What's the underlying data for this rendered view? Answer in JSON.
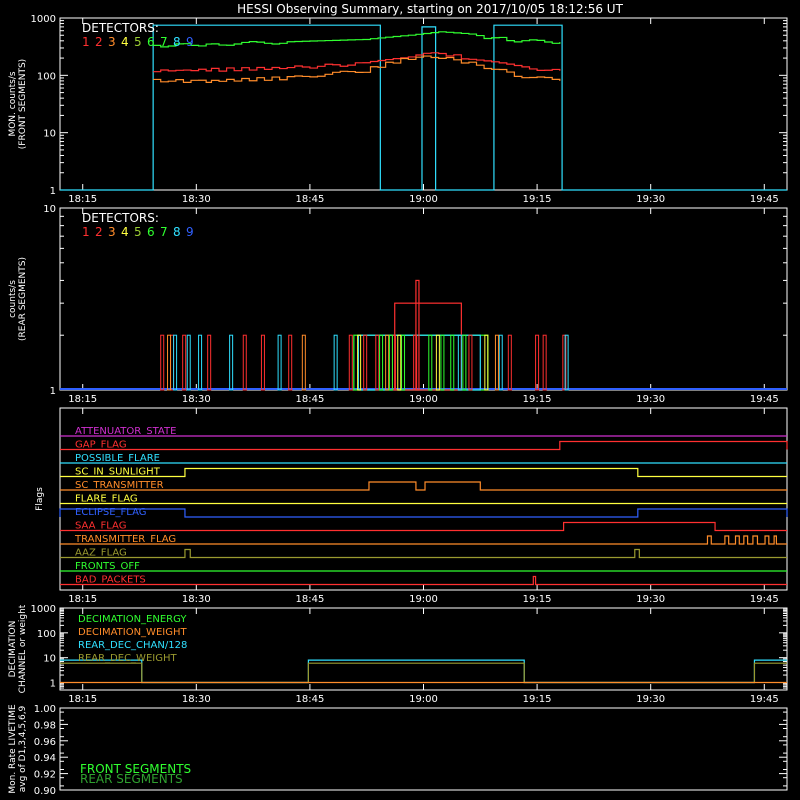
{
  "title": "HESSI Observing Summary, starting on 2017/10/05 18:12:56 UT",
  "colors": {
    "d1": "#ff3030",
    "d2": "#ff3030",
    "d3": "#ff8c2a",
    "d4": "#ffff40",
    "d5": "#9acd32",
    "d6": "#30ff30",
    "d7": "#30ff30",
    "d8": "#30e0ff",
    "d9": "#3060ff",
    "frame": "#ffffff"
  },
  "chart_data": [
    {
      "type": "line",
      "id": "front",
      "ylabel": "MON. counts/s\n(FRONT SEGMENTS)",
      "yscale": "log",
      "ylim": [
        1,
        1000
      ],
      "yticks": [
        "1",
        "10",
        "100",
        "1000"
      ],
      "xlim_min": [
        0,
        96
      ],
      "xticks": [
        "18:15",
        "18:30",
        "18:45",
        "19:00",
        "19:15",
        "19:30",
        "19:45"
      ],
      "xticks_min": [
        3,
        18,
        33,
        48,
        63,
        78,
        93
      ],
      "legend_title": "DETECTORS:",
      "legend": [
        "1",
        "2",
        "3",
        "4",
        "5",
        "6",
        "7",
        "8",
        "9"
      ],
      "series": [
        {
          "color": "#30e0ff",
          "x_min": [
            0,
            12,
            12.3,
            42,
            42.3,
            47.5,
            47.8,
            49.3,
            49.6,
            57,
            57.3,
            66,
            66.3,
            96
          ],
          "y": [
            1,
            1,
            750,
            750,
            1,
            1,
            700,
            700,
            1,
            1,
            750,
            750,
            1,
            1
          ]
        },
        {
          "color": "#30ff30",
          "x_min": [
            12.3,
            20,
            30,
            40,
            46,
            50,
            54,
            60,
            66
          ],
          "y": [
            330,
            350,
            380,
            420,
            520,
            560,
            500,
            400,
            380
          ]
        },
        {
          "color": "#ff3030",
          "x_min": [
            12.3,
            20,
            30,
            40,
            46,
            50,
            54,
            60,
            66
          ],
          "y": [
            120,
            125,
            135,
            160,
            220,
            240,
            190,
            140,
            120
          ]
        },
        {
          "color": "#ff8c2a",
          "x_min": [
            12.3,
            20,
            30,
            40,
            46,
            50,
            54,
            60,
            66
          ],
          "y": [
            80,
            80,
            90,
            120,
            200,
            210,
            160,
            100,
            80
          ]
        }
      ]
    },
    {
      "type": "line",
      "id": "rear",
      "ylabel": "counts/s\n(REAR SEGMENTS)",
      "yscale": "log",
      "ylim": [
        1,
        10
      ],
      "yticks": [
        "1",
        "10"
      ],
      "xlim_min": [
        0,
        96
      ],
      "xticks": [
        "18:15",
        "18:30",
        "18:45",
        "19:00",
        "19:15",
        "19:30",
        "19:45"
      ],
      "xticks_min": [
        3,
        18,
        33,
        48,
        63,
        78,
        93
      ],
      "legend_title": "DETECTORS:",
      "legend": [
        "1",
        "2",
        "3",
        "4",
        "5",
        "6",
        "7",
        "8",
        "9"
      ],
      "spikes": [
        {
          "color": "#ff3030",
          "x_min": [
            13.3,
            14.6,
            16.2,
            19.5,
            24.2,
            26.6,
            30.2,
            38.2,
            40.1,
            41.7,
            43.9,
            46.7,
            54.0,
            59.2,
            62.8,
            63.8,
            66.4
          ],
          "y": 2
        },
        {
          "color": "#30e0ff",
          "x_min": [
            15.0,
            16.8,
            18.3,
            22.4,
            28.8,
            36.2,
            52.6,
            58.0,
            66.7
          ],
          "y": 2
        },
        {
          "color": "#ff8c2a",
          "x_min": [
            14.2,
            32.0,
            43.0,
            57.5
          ],
          "y": 2
        },
        {
          "color": "#30ff30",
          "x_min": [
            42.2,
            43.5,
            45.1,
            48.7,
            50.3,
            51.6,
            53.2
          ],
          "y": 2
        },
        {
          "color": "#ffff40",
          "x_min": [
            39.3,
            44.6,
            49.7,
            56.1
          ],
          "y": 2
        }
      ],
      "bands": [
        {
          "color": "#30ff30",
          "x_min": [
            38.8,
            56.5
          ],
          "y": 2
        },
        {
          "color": "#30e0ff",
          "x_min": [
            39.4,
            55.5
          ],
          "y": 2
        },
        {
          "color": "#ff3030",
          "x_min": [
            44.2,
            53.0
          ],
          "y": 3
        },
        {
          "color": "#ff3030",
          "x_min": [
            47.0,
            47.4
          ],
          "y": 4
        }
      ],
      "baseline_color": "#3060ff"
    },
    {
      "type": "table",
      "id": "flags",
      "ylabel": "Flags",
      "xticks": [
        "18:15",
        "18:30",
        "18:45",
        "19:00",
        "19:15",
        "19:30",
        "19:45"
      ],
      "xticks_min": [
        3,
        18,
        33,
        48,
        63,
        78,
        93
      ],
      "flags": [
        {
          "name": "ATTENUATOR_STATE",
          "color": "#d030d0",
          "segments": []
        },
        {
          "name": "GAP_FLAG",
          "color": "#ff3030",
          "segments": [
            [
              66,
              96
            ]
          ]
        },
        {
          "name": "POSSIBLE_FLARE",
          "color": "#30e0ff",
          "segments": []
        },
        {
          "name": "SC_IN_SUNLIGHT",
          "color": "#ffff40",
          "segments": [
            [
              16.5,
              76.3
            ]
          ]
        },
        {
          "name": "SC_TRANSMITTER",
          "color": "#ff8c2a",
          "segments": [
            [
              40.8,
              47
            ],
            [
              48.2,
              55.5
            ]
          ]
        },
        {
          "name": "FLARE_FLAG",
          "color": "#ffff40",
          "segments": []
        },
        {
          "name": "ECLIPSE_FLAG",
          "color": "#3060ff",
          "segments": [
            [
              0,
              16.5
            ],
            [
              76.3,
              96
            ]
          ]
        },
        {
          "name": "SAA_FLAG",
          "color": "#ff3030",
          "segments": [
            [
              66.5,
              86.5
            ]
          ]
        },
        {
          "name": "TRANSMITTER_FLAG",
          "color": "#ff8c2a",
          "segments": [
            [
              85.5,
              86
            ],
            [
              87.8,
              88.3
            ],
            [
              89.2,
              89.7
            ],
            [
              90.3,
              90.8
            ],
            [
              91.5,
              92.1
            ],
            [
              93.1,
              93.6
            ],
            [
              94.3,
              94.6
            ]
          ]
        },
        {
          "name": "AAZ_FLAG",
          "color": "#9a9a30",
          "segments": [
            [
              16.5,
              17.2
            ],
            [
              75.9,
              76.5
            ]
          ]
        },
        {
          "name": "FRONTS_OFF",
          "color": "#30ff30",
          "segments": []
        },
        {
          "name": "BAD_PACKETS",
          "color": "#ff3030",
          "segments": [
            [
              62.5,
              62.8
            ]
          ]
        }
      ]
    },
    {
      "type": "line",
      "id": "decimation",
      "ylabel": "DECIMATION\nCHANNEL or weight",
      "yscale": "log",
      "ylim": [
        0.5,
        1000
      ],
      "yticks": [
        "1",
        "10",
        "100",
        "1000"
      ],
      "xlim_min": [
        0,
        96
      ],
      "xticks": [
        "18:15",
        "18:30",
        "18:45",
        "19:00",
        "19:15",
        "19:30",
        "19:45"
      ],
      "xticks_min": [
        3,
        18,
        33,
        48,
        63,
        78,
        93
      ],
      "legend": [
        "DECIMATION_ENERGY",
        "DECIMATION_WEIGHT",
        "REAR_DEC_CHAN/128",
        "REAR_DEC_WEIGHT"
      ],
      "legend_colors": [
        "#30ff30",
        "#ff8c2a",
        "#30e0ff",
        "#9a9a30"
      ],
      "series": [
        {
          "color": "#30e0ff",
          "x_min": [
            0,
            10.8,
            10.8,
            32.8,
            32.8,
            61.3,
            61.3,
            91.7,
            91.7,
            96
          ],
          "y": [
            8,
            8,
            1,
            1,
            8,
            8,
            1,
            1,
            8,
            8
          ]
        },
        {
          "color": "#9a9a30",
          "x_min": [
            0,
            10.8,
            10.8,
            32.8,
            32.8,
            61.3,
            61.3,
            91.7,
            91.7,
            96
          ],
          "y": [
            6,
            6,
            1,
            1,
            6,
            6,
            1,
            1,
            6,
            6
          ]
        },
        {
          "color": "#ff8c2a",
          "x_min": [
            0,
            96
          ],
          "y": [
            1,
            1
          ]
        }
      ]
    },
    {
      "type": "line",
      "id": "livetime",
      "ylabel": "Mon. Rate LIVETIME\navg of D1,3,4,5,6,9",
      "ylim": [
        0.9,
        1.0
      ],
      "yticks": [
        "0.90",
        "0.92",
        "0.94",
        "0.96",
        "0.98",
        "1.00"
      ],
      "legend": [
        "FRONT SEGMENTS",
        "REAR SEGMENTS"
      ],
      "legend_colors": [
        "#30ff30",
        "#2fa02f"
      ]
    }
  ]
}
